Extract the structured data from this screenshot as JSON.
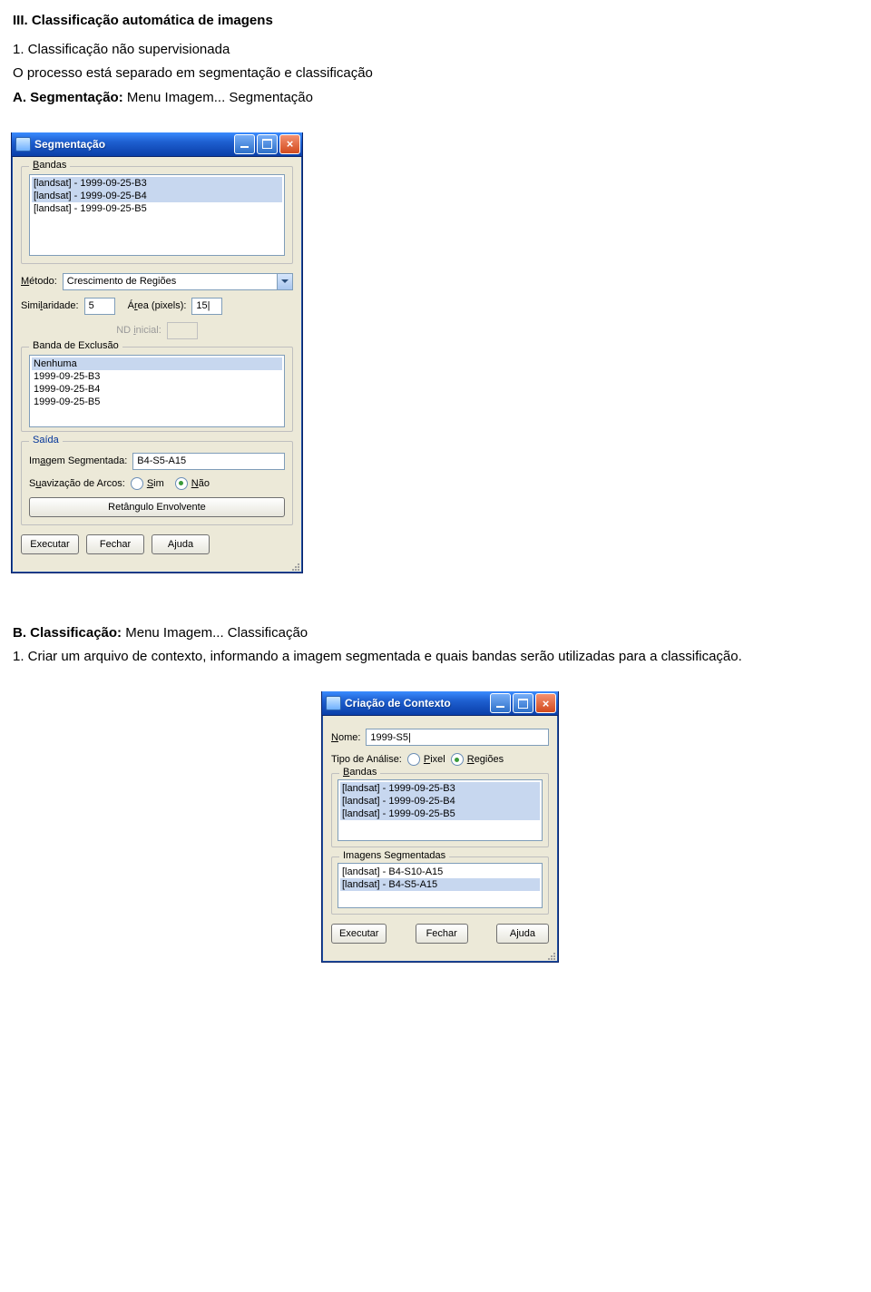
{
  "doc": {
    "heading": "III. Classificação automática de imagens",
    "p1": "1. Classificação não supervisionada",
    "p2": "O processo está separado em segmentação e classificação",
    "secA_bold": "A. Segmentação:",
    "secA_rest": " Menu Imagem... Segmentação",
    "secB_bold": "B. Classificação:",
    "secB_rest": " Menu Imagem... Classificação",
    "p3": "1. Criar um arquivo de contexto, informando a imagem segmentada e quais bandas serão utilizadas para a classificação."
  },
  "win1": {
    "title": "Segmentação",
    "bandas": {
      "legend": "Bandas",
      "items": [
        "[landsat] - 1999-09-25-B3",
        "[landsat] - 1999-09-25-B4",
        "[landsat] - 1999-09-25-B5"
      ]
    },
    "metodo": {
      "label": "Método:",
      "value": "Crescimento de Regiões"
    },
    "similaridade": {
      "label": "Similaridade:",
      "value": "5"
    },
    "area": {
      "label": "Área (pixels):",
      "value": "15|"
    },
    "nd_inicial": {
      "label": "ND inicial:"
    },
    "exclusao": {
      "legend": "Banda de Exclusão",
      "items": [
        "Nenhuma",
        "1999-09-25-B3",
        "1999-09-25-B4",
        "1999-09-25-B5"
      ]
    },
    "saida": {
      "legend": "Saída",
      "imagem_label": "Imagem Segmentada:",
      "imagem_value": "B4-S5-A15",
      "suavizacao_label": "Suavização de Arcos:",
      "sim": "Sim",
      "nao": "Não",
      "retangulo": "Retângulo Envolvente"
    },
    "buttons": {
      "executar": "Executar",
      "fechar": "Fechar",
      "ajuda": "Ajuda"
    }
  },
  "win2": {
    "title": "Criação de Contexto",
    "nome": {
      "label": "Nome:",
      "value": "1999-S5|"
    },
    "tipo": {
      "label": "Tipo de Análise:",
      "pixel": "Pixel",
      "regioes": "Regiões"
    },
    "bandas": {
      "legend": "Bandas",
      "items": [
        "[landsat] - 1999-09-25-B3",
        "[landsat] - 1999-09-25-B4",
        "[landsat] - 1999-09-25-B5"
      ]
    },
    "segmentadas": {
      "legend": "Imagens Segmentadas",
      "items": [
        "[landsat] - B4-S10-A15",
        "[landsat] - B4-S5-A15"
      ]
    },
    "buttons": {
      "executar": "Executar",
      "fechar": "Fechar",
      "ajuda": "Ajuda"
    }
  }
}
